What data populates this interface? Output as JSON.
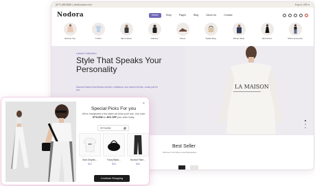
{
  "browser": {
    "topbar_left": "(877) 888-8866 | info@nodora.com",
    "topbar_right": "Eng ▾ | USD ▾",
    "logo": "Nodora",
    "nav": [
      "Home",
      "Shop",
      "Pages",
      "Blog",
      "About Us",
      "Contact"
    ],
    "categories": [
      "Woman Top",
      "T-Shirt",
      "Men's Wear",
      "Glasses",
      "Shoes",
      "Stylish Bag",
      "Winter Wear",
      "Skirt Dress",
      "Shirts and pants"
    ],
    "hero": {
      "eyebrow": "Latest Collection",
      "title": "Style That Speaks Your Personality",
      "description": "Discover fashion that blends comfort, confidence, and modern trends—made just for you.",
      "hoodie_text": "LA MAISON"
    },
    "best_seller": {
      "title": "Best Seller",
      "subtitle": "Discover Our Most Loved Bestsellers"
    }
  },
  "popup": {
    "title": "Special Picks For you",
    "message_pre": "We've handpicked a few styles we think you'll love. Use code ",
    "code_inline": "STYLE30",
    "message_mid": " for ",
    "discount": "30% OFF",
    "message_post": " your order today.",
    "code": "STYLE30",
    "products": [
      {
        "name": "Bow Graphic...",
        "price": "$12"
      },
      {
        "name": "Fuzzy Black...",
        "price": "$33"
      },
      {
        "name": "Bootcut Flare...",
        "price": "$40"
      }
    ],
    "cta": "Continue Shopping"
  },
  "colors": {
    "accent": "#6f68b6",
    "popup_border": "#f1cfe2",
    "hero_bg": "#ece8ef",
    "button_bg": "#1c1c1c"
  }
}
